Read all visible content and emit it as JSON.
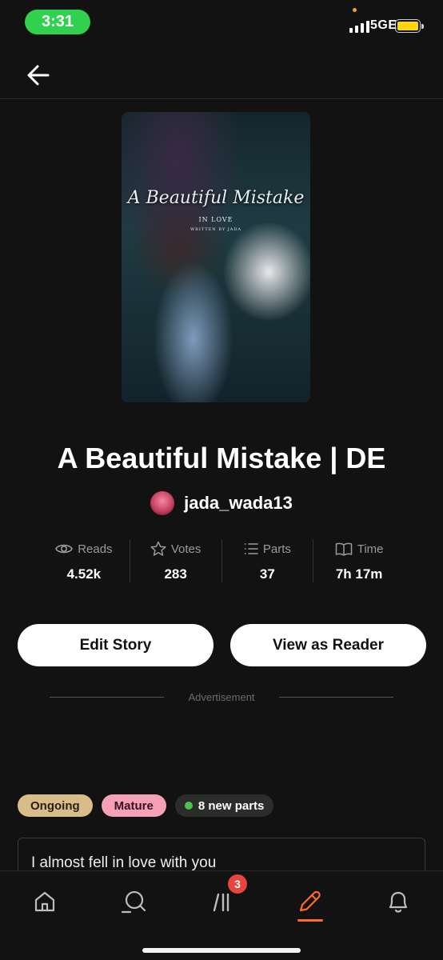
{
  "status_bar": {
    "time": "3:31",
    "network": "5GE",
    "colors": {
      "time_pill": "#2fd14f",
      "battery": "#ffd60a"
    }
  },
  "story": {
    "cover": {
      "title": "A Beautiful Mistake",
      "subtitle": "IN LOVE",
      "byline": "WRITTEN BY JADA"
    },
    "title": "A Beautiful Mistake | DE",
    "author": "jada_wada13"
  },
  "stats": [
    {
      "icon": "eye-icon",
      "label": "Reads",
      "value": "4.52k"
    },
    {
      "icon": "star-icon",
      "label": "Votes",
      "value": "283"
    },
    {
      "icon": "list-icon",
      "label": "Parts",
      "value": "37"
    },
    {
      "icon": "book-icon",
      "label": "Time",
      "value": "7h 17m"
    }
  ],
  "actions": {
    "edit_label": "Edit Story",
    "reader_label": "View as Reader"
  },
  "advertisement_label": "Advertisement",
  "tags": {
    "ongoing": "Ongoing",
    "mature": "Mature",
    "new_parts": "8 new parts"
  },
  "description": "I almost fell in love with you",
  "bottom_nav": {
    "items": [
      "home-icon",
      "search-icon",
      "library-icon",
      "write-icon",
      "bell-icon"
    ],
    "library_badge": "3",
    "active": "write-icon",
    "colors": {
      "active": "#ff6a2b",
      "badge": "#e8453c"
    }
  }
}
